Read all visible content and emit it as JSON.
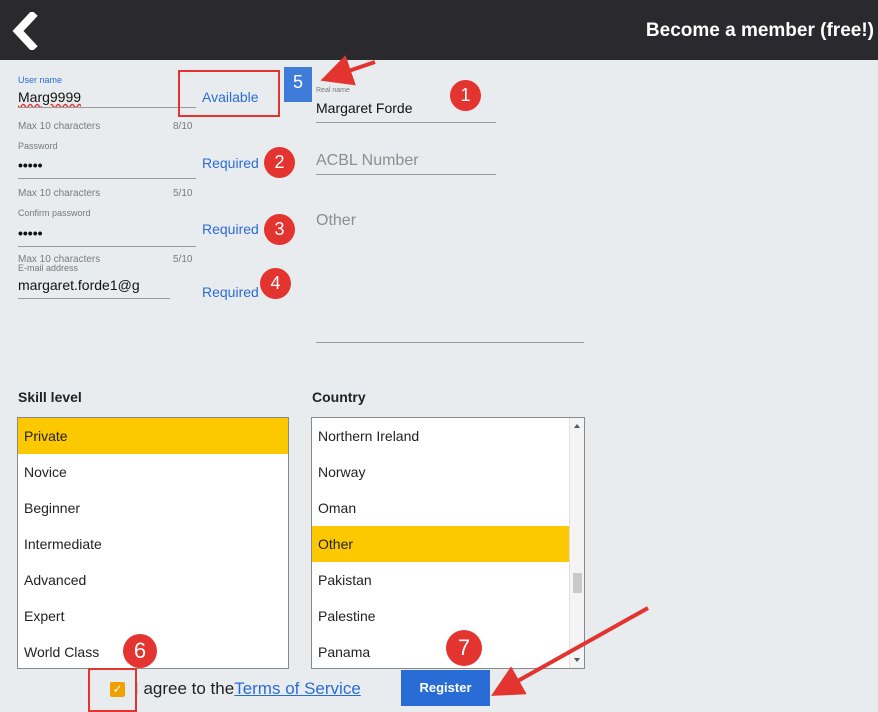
{
  "header": {
    "title": "Become a member (free!)",
    "back_icon": "chevron-left-icon"
  },
  "form": {
    "username": {
      "label": "User name",
      "value": "Marg9999",
      "hint": "Max 10 characters",
      "count": "8/10",
      "status": "Available"
    },
    "password": {
      "label": "Password",
      "value": "•••••",
      "hint": "Max 10 characters",
      "count": "5/10",
      "status": "Required"
    },
    "confirm_password": {
      "label": "Confirm password",
      "value": "•••••",
      "hint": "Max 10 characters",
      "count": "5/10",
      "status": "Required"
    },
    "email": {
      "label": "E-mail address",
      "value": "margaret.forde1@g",
      "status": "Required"
    },
    "real_name": {
      "label": "Real name",
      "value": "Margaret Forde"
    },
    "acbl_number": {
      "placeholder": "ACBL Number"
    },
    "other": {
      "placeholder": "Other"
    }
  },
  "skill": {
    "label": "Skill level",
    "items": [
      "Private",
      "Novice",
      "Beginner",
      "Intermediate",
      "Advanced",
      "Expert",
      "World Class"
    ],
    "selected": "Private"
  },
  "country": {
    "label": "Country",
    "items": [
      "Northern Ireland",
      "Norway",
      "Oman",
      "Other",
      "Pakistan",
      "Palestine",
      "Panama"
    ],
    "selected": "Other"
  },
  "terms": {
    "checked": true,
    "text": "I agree to the",
    "link": "Terms of Service"
  },
  "register_label": "Register",
  "annotations": {
    "badge_1": "1",
    "badge_2": "2",
    "badge_3": "3",
    "badge_4": "4",
    "badge_5": "5",
    "badge_6": "6",
    "badge_7": "7"
  },
  "colors": {
    "header_bg": "#2a2a2e",
    "accent_blue": "#2a6cd6",
    "selection_yellow": "#fcc800",
    "annotation_red": "#e3342f",
    "checkbox_orange": "#f0a000"
  }
}
